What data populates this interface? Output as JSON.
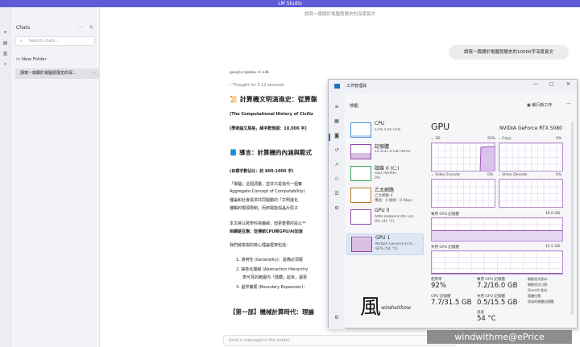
{
  "app": {
    "title": "LM Studio"
  },
  "rail": {
    "icons": [
      "chat-icon",
      "folder-icon",
      "library-icon",
      "search-models-icon"
    ]
  },
  "chats": {
    "header": "Chats",
    "search_placeholder": "Search chats...",
    "new_folder": "New Folder",
    "items": [
      {
        "label": "請寫一篇關於電腦發展史的深...",
        "menu": "···"
      }
    ]
  },
  "main": {
    "breadcrumb": "請寫一篇關於電腦發展史的深度長文",
    "user_message": "請寫一篇關於電腦發展史的10000字深度長文",
    "model_id": "google/gemma-4-e4b",
    "thought": "Thought for 5.12 seconds",
    "title": "📜 計算機文明演進史：從算盤",
    "subtitle": "(The Computational History of Civiliz",
    "meta": "[學術論文風格，總字數預期：10,000 字]",
    "intro_heading": "📘 導言：計算機的內涵與範式",
    "intro_goal": "(目標字數佔比：約 800-1000 字)",
    "para1_a": "「電腦」這個詞彙，並非只是指代一個實",
    "para1_b": "Aggregate Concept of Computability)",
    "para1_c": "種論和社會需求共同驅動的「文明進化",
    "para1_d": "邏輯的根源限制，而到電能與晶片原子",
    "para2_a": "本文將以跨學科為軸線，但更重要的是以**",
    "para2_b": "到網路互聯；從傳統CPU到GPU/AI加速",
    "para3": "我們將檢視的核心理論框架包括：",
    "list": [
      "1. 通用性 (Generality)：設備必須展",
      "2. 抽象化層級 (Abstraction Hierarchy",
      "表可見的範圍內「隱藏」起來，讓更",
      "3. 邊界擴展 (Boundary Expansion)："
    ],
    "part_heading": "【第一部】機械計算時代：理論",
    "input_placeholder": "Send a message to the model..."
  },
  "taskmanager": {
    "title": "工作管理員",
    "toolbar_label": "效能",
    "run_task": "執行新工作",
    "devices": [
      {
        "name": "CPU",
        "sub1": "12% 5.05 GHz",
        "sub2": "",
        "usage": 0.12,
        "color": "#4a90d9"
      },
      {
        "name": "記憶體",
        "sub1": "12.4/31.0 GB (40%)",
        "sub2": "",
        "usage": 0.4,
        "color": "#8e44ad"
      },
      {
        "name": "磁碟 0 (C:)",
        "sub1": "SSD (NVMe)",
        "sub2": "0%",
        "usage": 0.0,
        "color": "#3aa55a"
      },
      {
        "name": "乙太網路",
        "sub1": "乙太網路 4",
        "sub2": "傳送：0 接收：0 Kbps",
        "usage": 0.0,
        "color": "#b07a2a"
      },
      {
        "name": "GPU 0",
        "sub1": "AMD Radeon(TM) Gra",
        "sub2": "0% (41 °C)",
        "usage": 0.0,
        "color": "#8e44ad"
      },
      {
        "name": "GPU 1",
        "sub1": "NVIDIA GeForce RTX...",
        "sub2": "92% (54 °C)",
        "usage": 0.92,
        "color": "#8e44ad"
      }
    ],
    "gpu": {
      "heading": "GPU",
      "model": "NVIDIA GeForce RTX 5080",
      "engines": [
        {
          "name": "3D",
          "pct": "93%"
        },
        {
          "name": "Copy",
          "pct": "0%"
        },
        {
          "name": "Video Encode",
          "pct": "0%"
        },
        {
          "name": "Video Decode",
          "pct": "0%"
        }
      ],
      "dedicated_label": "專用 GPU 記憶體",
      "dedicated_max": "16.0 GB",
      "shared_label": "共用 GPU 記憶體",
      "shared_max": "15.5 GB",
      "stats": {
        "util_label": "使用率",
        "util_value": "92%",
        "dedicated_usage_label": "專用 GPU 記憶體",
        "dedicated_usage_value": "7.2/16.0 GB",
        "gpu_mem_label": "GPU 記憶體",
        "gpu_mem_value": "7.7/31.5 GB",
        "shared_usage_label": "共用 GPU 記憶體",
        "shared_usage_value": "0.5/15.5 GB",
        "temp_label": "溫度",
        "temp_value": "54 °C"
      },
      "side_labels": [
        "驅動程式版本:",
        "驅動程式日期:",
        "DirectX 版本:",
        "實體位置:",
        "保留的硬體記憶體:"
      ]
    }
  },
  "logo": {
    "glyph": "風",
    "text": "windwithme"
  },
  "watermark": "windwithme@ePrice"
}
